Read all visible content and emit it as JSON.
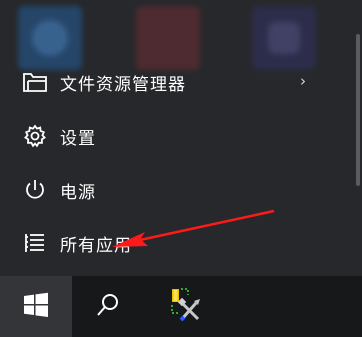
{
  "start_menu": {
    "items": [
      {
        "label": "文件资源管理器",
        "icon": "folder-icon",
        "has_submenu": true
      },
      {
        "label": "设置",
        "icon": "gear-icon"
      },
      {
        "label": "电源",
        "icon": "power-icon"
      },
      {
        "label": "所有应用",
        "icon": "list-icon"
      }
    ],
    "submenu_glyph": "›"
  },
  "taskbar": {
    "start_icon": "windows-logo-icon",
    "search_icon": "search-icon",
    "app_icon": "tools-app-icon"
  },
  "annotation": {
    "arrow_color": "#ff1a1a"
  }
}
